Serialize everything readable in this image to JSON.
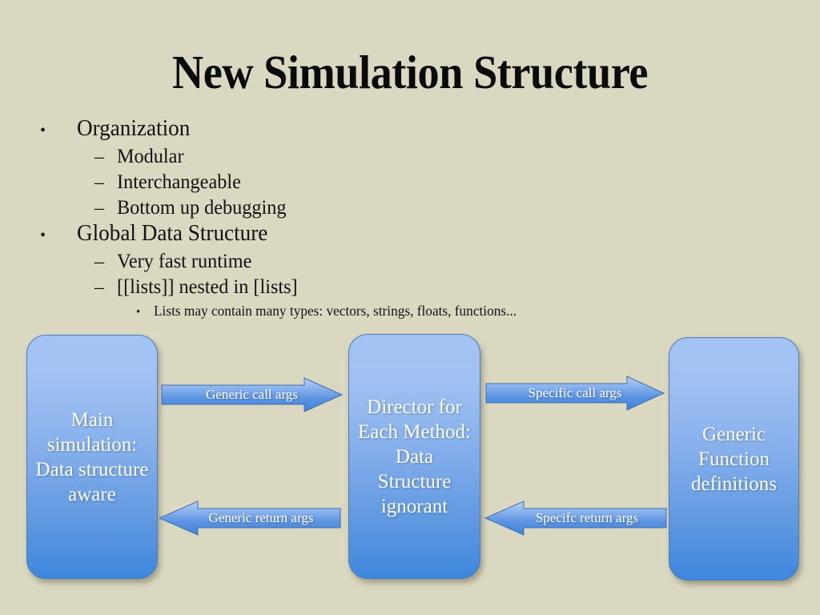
{
  "slide": {
    "title": "New Simulation Structure",
    "background_color": "#dad8c0",
    "bullets": [
      {
        "level": 1,
        "marker": "•",
        "text": "Organization"
      },
      {
        "level": 2,
        "marker": "–",
        "text": "Modular"
      },
      {
        "level": 2,
        "marker": "–",
        "text": "Interchangeable"
      },
      {
        "level": 2,
        "marker": "–",
        "text": "Bottom up debugging"
      },
      {
        "level": 1,
        "marker": "•",
        "text": "Global Data Structure"
      },
      {
        "level": 2,
        "marker": "–",
        "text": "Very fast runtime"
      },
      {
        "level": 2,
        "marker": "–",
        "text": "[[lists]] nested in [lists]"
      },
      {
        "level": 3,
        "marker": "•",
        "text": "Lists may contain many types: vectors, strings, floats, functions..."
      }
    ]
  },
  "diagram": {
    "accent_color": "#4f88dd",
    "box_text_color": "#ffffff",
    "boxes": [
      {
        "id": "main",
        "label": "Main simulation: Data structure aware"
      },
      {
        "id": "director",
        "label": "Director for Each Method: Data Structure ignorant"
      },
      {
        "id": "generic",
        "label": "Generic Function definitions"
      }
    ],
    "arrows": [
      {
        "id": "generic-call",
        "label": "Generic call args",
        "direction": "right",
        "from": "main",
        "to": "director"
      },
      {
        "id": "specific-call",
        "label": "Specific call args",
        "direction": "right",
        "from": "director",
        "to": "generic"
      },
      {
        "id": "generic-return",
        "label": "Generic return args",
        "direction": "left",
        "from": "director",
        "to": "main"
      },
      {
        "id": "specific-return",
        "label": "Specifc return args",
        "direction": "left",
        "from": "generic",
        "to": "director"
      }
    ]
  }
}
